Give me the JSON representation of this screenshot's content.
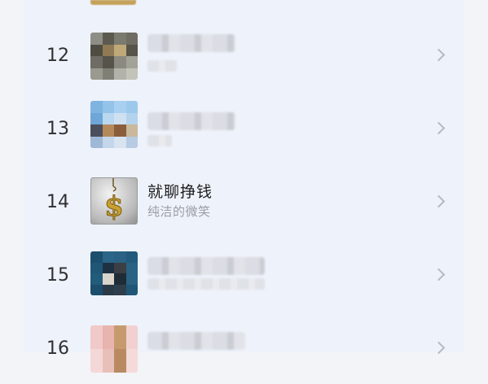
{
  "list": [
    {
      "rank": "12",
      "title": "",
      "subtitle": "",
      "thumb_icon": "blurred-thumbnail"
    },
    {
      "rank": "13",
      "title": "",
      "subtitle": "",
      "thumb_icon": "blurred-thumbnail"
    },
    {
      "rank": "14",
      "title": "就聊挣钱",
      "subtitle": "纯洁的微笑",
      "thumb_icon": "dollar-sign-pendant"
    },
    {
      "rank": "15",
      "title": "",
      "subtitle": "",
      "thumb_icon": "blurred-thumbnail"
    },
    {
      "rank": "16",
      "title": "",
      "subtitle": "",
      "thumb_icon": "blurred-thumbnail"
    }
  ],
  "colors": {
    "background": "#f3f4f7",
    "panel": "#eef2fa",
    "rank_text": "#303033",
    "subtitle": "#9a9ca2"
  }
}
